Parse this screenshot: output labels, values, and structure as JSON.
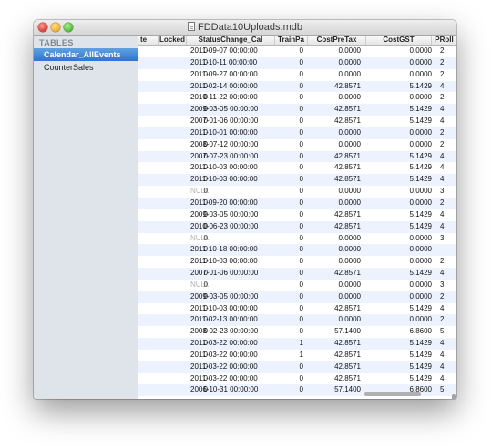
{
  "window": {
    "title": "FDData10Uploads.mdb"
  },
  "sidebar": {
    "header": "TABLES",
    "items": [
      {
        "label": "Calendar_AllEvents",
        "selected": true
      },
      {
        "label": "CounterSales",
        "selected": false
      }
    ]
  },
  "table": {
    "columns": [
      "te",
      "Locked",
      "StatusChange_Cal",
      "TrainPa",
      "CostPreTax",
      "CostGST",
      "PRoll"
    ],
    "rows": [
      [
        "0",
        "2011-09-07 00:00:00",
        "0",
        "0.0000",
        "0.0000",
        "2"
      ],
      [
        "0",
        "2011-10-11 00:00:00",
        "0",
        "0.0000",
        "0.0000",
        "2"
      ],
      [
        "0",
        "2011-09-27 00:00:00",
        "0",
        "0.0000",
        "0.0000",
        "2"
      ],
      [
        "0",
        "2011-02-14 00:00:00",
        "0",
        "42.8571",
        "5.1429",
        "4"
      ],
      [
        "0",
        "2010-11-22 00:00:00",
        "0",
        "0.0000",
        "0.0000",
        "2"
      ],
      [
        "0",
        "2009-03-05 00:00:00",
        "0",
        "42.8571",
        "5.1429",
        "4"
      ],
      [
        "0",
        "2007-01-06 00:00:00",
        "0",
        "42.8571",
        "5.1429",
        "4"
      ],
      [
        "0",
        "2011-10-01 00:00:00",
        "0",
        "0.0000",
        "0.0000",
        "2"
      ],
      [
        "0",
        "2008-07-12 00:00:00",
        "0",
        "0.0000",
        "0.0000",
        "2"
      ],
      [
        "0",
        "2007-07-23 00:00:00",
        "0",
        "42.8571",
        "5.1429",
        "4"
      ],
      [
        "0",
        "2011-10-03 00:00:00",
        "0",
        "42.8571",
        "5.1429",
        "4"
      ],
      [
        "0",
        "2011-10-03 00:00:00",
        "0",
        "42.8571",
        "5.1429",
        "4"
      ],
      [
        "0",
        "NULL",
        "0",
        "0.0000",
        "0.0000",
        "3"
      ],
      [
        "0",
        "2011-09-20 00:00:00",
        "0",
        "0.0000",
        "0.0000",
        "2"
      ],
      [
        "0",
        "2009-03-05 00:00:00",
        "0",
        "42.8571",
        "5.1429",
        "4"
      ],
      [
        "0",
        "2010-06-23 00:00:00",
        "0",
        "42.8571",
        "5.1429",
        "4"
      ],
      [
        "0",
        "NULL",
        "0",
        "0.0000",
        "0.0000",
        "3"
      ],
      [
        "0",
        "2011-10-18 00:00:00",
        "0",
        "0.0000",
        "0.0000",
        ""
      ],
      [
        "0",
        "2011-10-03 00:00:00",
        "0",
        "0.0000",
        "0.0000",
        "2"
      ],
      [
        "0",
        "2007-01-06 00:00:00",
        "0",
        "42.8571",
        "5.1429",
        "4"
      ],
      [
        "0",
        "NULL",
        "0",
        "0.0000",
        "0.0000",
        "3"
      ],
      [
        "0",
        "2009-03-05 00:00:00",
        "0",
        "0.0000",
        "0.0000",
        "2"
      ],
      [
        "0",
        "2011-10-03 00:00:00",
        "0",
        "42.8571",
        "5.1429",
        "4"
      ],
      [
        "0",
        "2011-02-13 00:00:00",
        "0",
        "0.0000",
        "0.0000",
        "2"
      ],
      [
        "0",
        "2008-02-23 00:00:00",
        "0",
        "57.1400",
        "6.8600",
        "5"
      ],
      [
        "0",
        "2011-03-22 00:00:00",
        "1",
        "42.8571",
        "5.1429",
        "4"
      ],
      [
        "0",
        "2011-03-22 00:00:00",
        "1",
        "42.8571",
        "5.1429",
        "4"
      ],
      [
        "0",
        "2011-03-22 00:00:00",
        "0",
        "42.8571",
        "5.1429",
        "4"
      ],
      [
        "0",
        "2011-03-22 00:00:00",
        "0",
        "42.8571",
        "5.1429",
        "4"
      ],
      [
        "0",
        "2006-10-31 00:00:00",
        "0",
        "57.1400",
        "6.8600",
        "5"
      ]
    ]
  }
}
